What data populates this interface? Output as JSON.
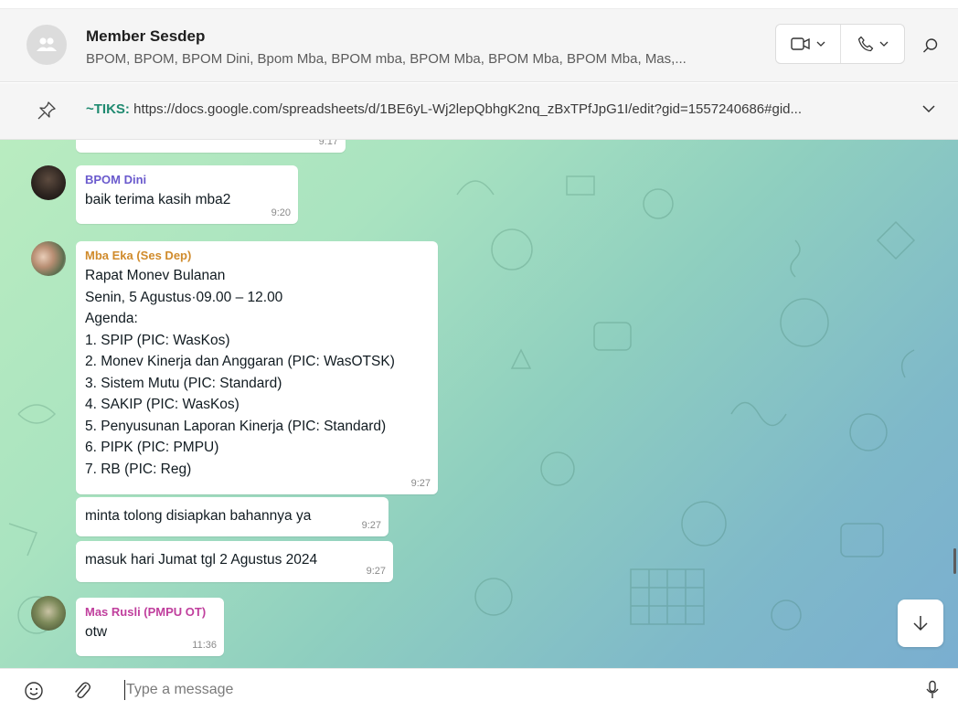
{
  "header": {
    "title": "Member Sesdep",
    "participants": "BPOM, BPOM, BPOM Dini, Bpom Mba, BPOM mba, BPOM Mba, BPOM Mba, BPOM Mba, Mas,..."
  },
  "pinned": {
    "author": "~TIKS:",
    "text": "https://docs.google.com/spreadsheets/d/1BE6yL-Wj2lepQbhgK2nq_zBxTPfJpG1I/edit?gid=1557240686#gid..."
  },
  "messages": [
    {
      "time": "9:17"
    },
    {
      "sender": "BPOM Dini",
      "sender_color": "#6a5acd",
      "text": "baik terima kasih mba2",
      "time": "9:20"
    },
    {
      "sender": "Mba Eka (Ses Dep)",
      "sender_color": "#d08b2c",
      "text": "Rapat Monev Bulanan\nSenin, 5 Agustus·09.00 – 12.00\nAgenda:\n1. SPIP (PIC: WasKos)\n2. Monev Kinerja dan Anggaran (PIC: WasOTSK)\n3. Sistem Mutu (PIC: Standard)\n4. SAKIP (PIC: WasKos)\n5. Penyusunan Laporan Kinerja (PIC: Standard)\n6. PIPK (PIC: PMPU)\n7. RB (PIC: Reg)",
      "time": "9:27"
    },
    {
      "text": "minta tolong disiapkan bahannya ya",
      "time": "9:27"
    },
    {
      "text": "masuk hari Jumat tgl 2 Agustus 2024",
      "time": "9:27"
    },
    {
      "sender": "Mas Rusli (PMPU OT)",
      "sender_color": "#c03f9d",
      "text": "otw",
      "time": "11:36"
    }
  ],
  "compose": {
    "placeholder": "Type a message"
  },
  "icons": {
    "group_avatar": "group-icon",
    "video": "video-camera-icon",
    "call": "phone-icon",
    "search": "search-icon",
    "pin": "pin-icon",
    "expand": "chevron-down-icon",
    "emoji": "emoji-icon",
    "attach": "paperclip-icon",
    "mic": "microphone-icon",
    "scroll": "arrow-down-icon"
  }
}
